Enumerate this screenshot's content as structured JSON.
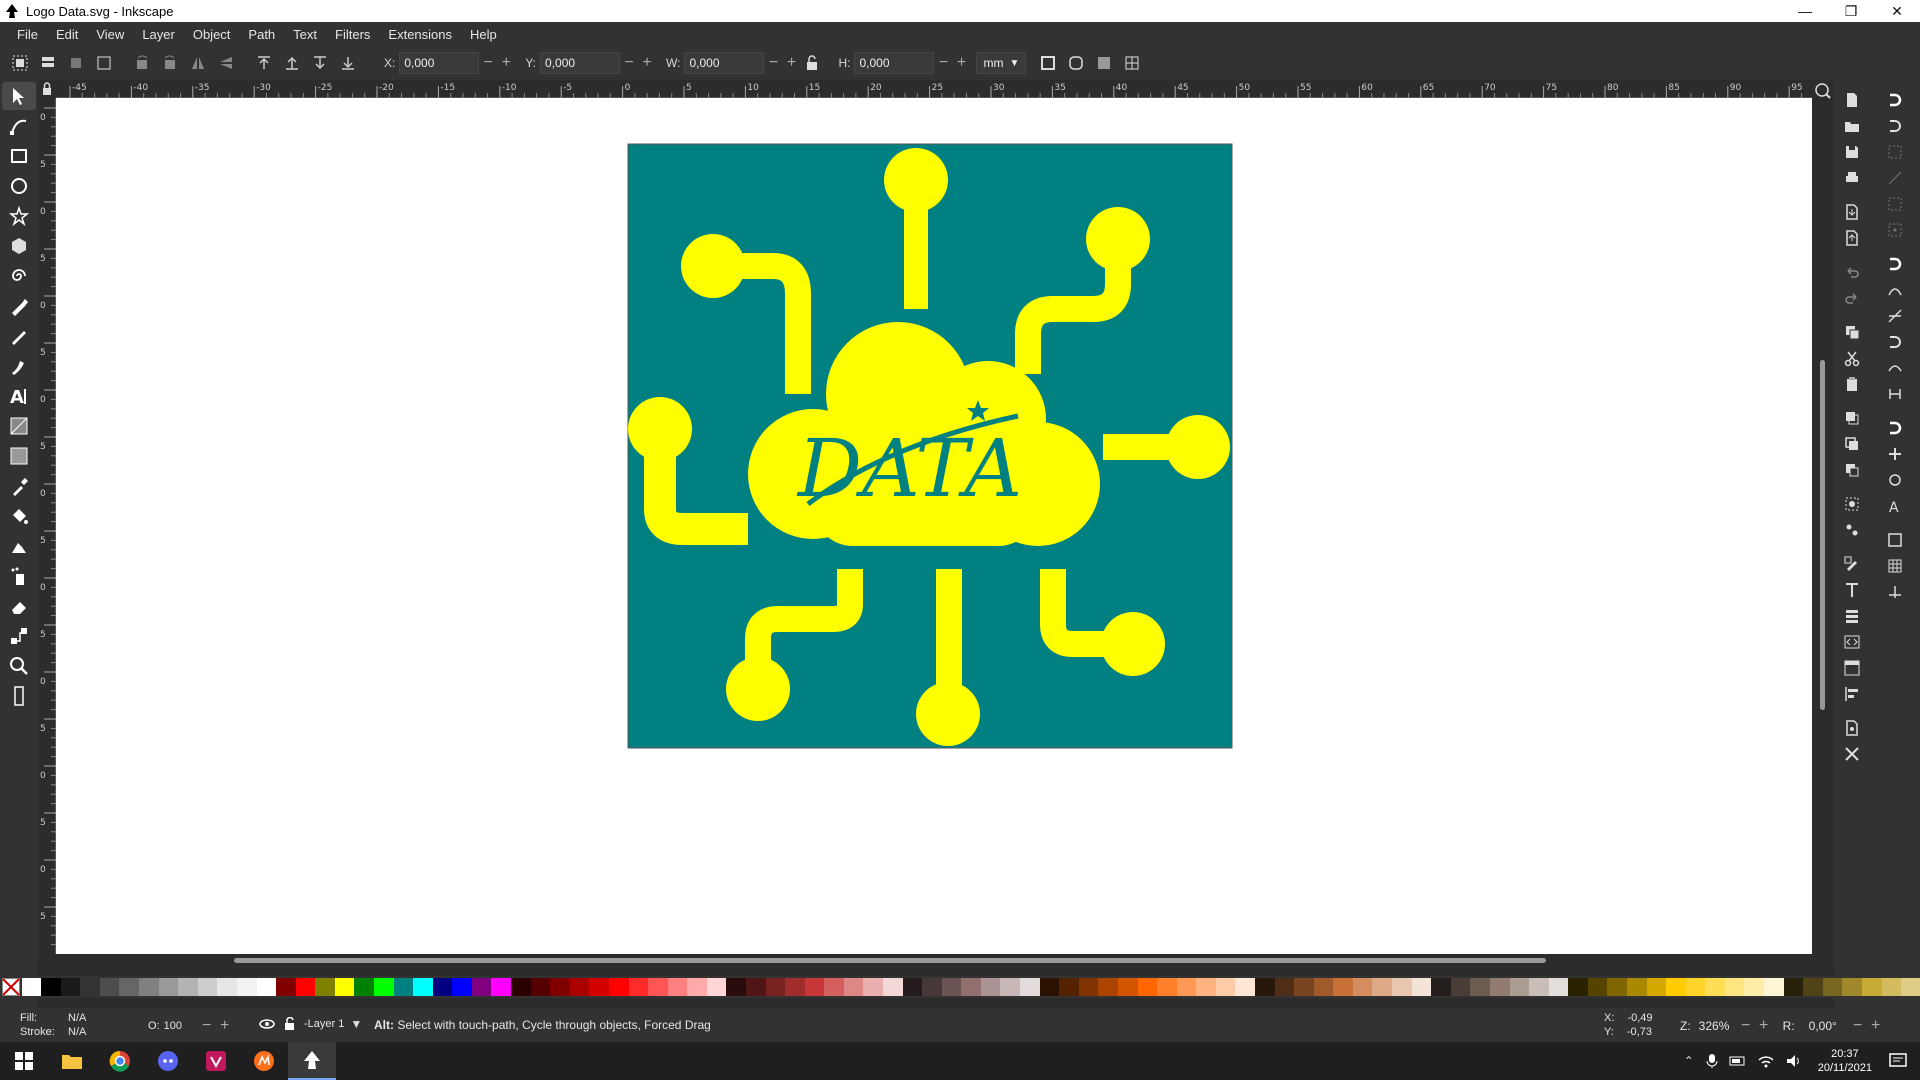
{
  "window": {
    "title": "Logo Data.svg - Inkscape",
    "minimize_glyph": "—",
    "maximize_glyph": "❐",
    "close_glyph": "✕"
  },
  "menu": [
    "File",
    "Edit",
    "View",
    "Layer",
    "Object",
    "Path",
    "Text",
    "Filters",
    "Extensions",
    "Help"
  ],
  "commandbar": {
    "x_label": "X:",
    "x_value": "0,000",
    "y_label": "Y:",
    "y_value": "0,000",
    "w_label": "W:",
    "w_value": "0,000",
    "h_label": "H:",
    "h_value": "0,000",
    "unit": "mm"
  },
  "ruler": {
    "top_labels": [
      "-45",
      "-40",
      "-35",
      "-30",
      "-25",
      "-20",
      "-15",
      "-10",
      "-5",
      "0",
      "5",
      "10",
      "15",
      "20",
      "25",
      "30",
      "35",
      "40",
      "45",
      "50",
      "55",
      "60",
      "65",
      "70",
      "75",
      "80",
      "85",
      "90",
      "95"
    ],
    "left_labels": [
      "0",
      "5",
      "0",
      "5",
      "0",
      "5",
      "0",
      "5",
      "0",
      "5",
      "0",
      "5",
      "0",
      "5",
      "0",
      "5",
      "0",
      "5"
    ]
  },
  "logo": {
    "text": "DATA",
    "background_color": "#008080",
    "foreground_color": "#ffff00"
  },
  "palette": [
    "#ffffff",
    "#000000",
    "#1a1a1a",
    "#333333",
    "#4d4d4d",
    "#666666",
    "#808080",
    "#999999",
    "#b3b3b3",
    "#cccccc",
    "#e6e6e6",
    "#f2f2f2",
    "#ffffff",
    "#800000",
    "#ff0000",
    "#808000",
    "#ffff00",
    "#008000",
    "#00ff00",
    "#008080",
    "#00ffff",
    "#000080",
    "#0000ff",
    "#800080",
    "#ff00ff",
    "#2b0000",
    "#550000",
    "#800000",
    "#aa0000",
    "#d40000",
    "#ff0000",
    "#ff2a2a",
    "#ff5555",
    "#ff8080",
    "#ffaaaa",
    "#ffd5d5",
    "#280b0b",
    "#501616",
    "#782121",
    "#a02c2c",
    "#c83737",
    "#d35f5f",
    "#de8787",
    "#e9afaf",
    "#f4d7d7",
    "#241c1c",
    "#483737",
    "#6c5353",
    "#916f6f",
    "#ac9393",
    "#c8b7b7",
    "#e3dbdb",
    "#2b1100",
    "#552200",
    "#803300",
    "#aa4400",
    "#d45500",
    "#ff6600",
    "#ff7f2a",
    "#ff9955",
    "#ffb380",
    "#ffccaa",
    "#ffe6d5",
    "#28170b",
    "#502d16",
    "#784421",
    "#a05a2c",
    "#c87137",
    "#d38d5f",
    "#deaa87",
    "#e9c6af",
    "#f4e3d7",
    "#241f1c",
    "#483e37",
    "#6c5d53",
    "#917c6f",
    "#ac9d93",
    "#c8beb7",
    "#e3dedb",
    "#2b2200",
    "#554400",
    "#806600",
    "#aa8800",
    "#d4aa00",
    "#ffcc00",
    "#ffd42a",
    "#ffdd55",
    "#ffe680",
    "#ffeeaa",
    "#fff6d5",
    "#28220b",
    "#504416",
    "#786721",
    "#a0892c",
    "#c8ab37",
    "#d3bc5f",
    "#decd87"
  ],
  "status": {
    "fill_label": "Fill:",
    "fill_value": "N/A",
    "stroke_label": "Stroke:",
    "stroke_value": "N/A",
    "opacity_label": "O:",
    "opacity_value": "100",
    "layer": "-Layer 1",
    "message_bold": "Alt:",
    "message": " Select with touch-path, Cycle through objects, Forced Drag",
    "x_label": "X:",
    "x_value": "-0,49",
    "y_label": "Y:",
    "y_value": "-0,73",
    "zoom_label": "Z:",
    "zoom_value": "326%",
    "rotate_label": "R:",
    "rotate_value": "0,00°"
  },
  "taskbar": {
    "time": "20:37",
    "date": "20/11/2021"
  }
}
